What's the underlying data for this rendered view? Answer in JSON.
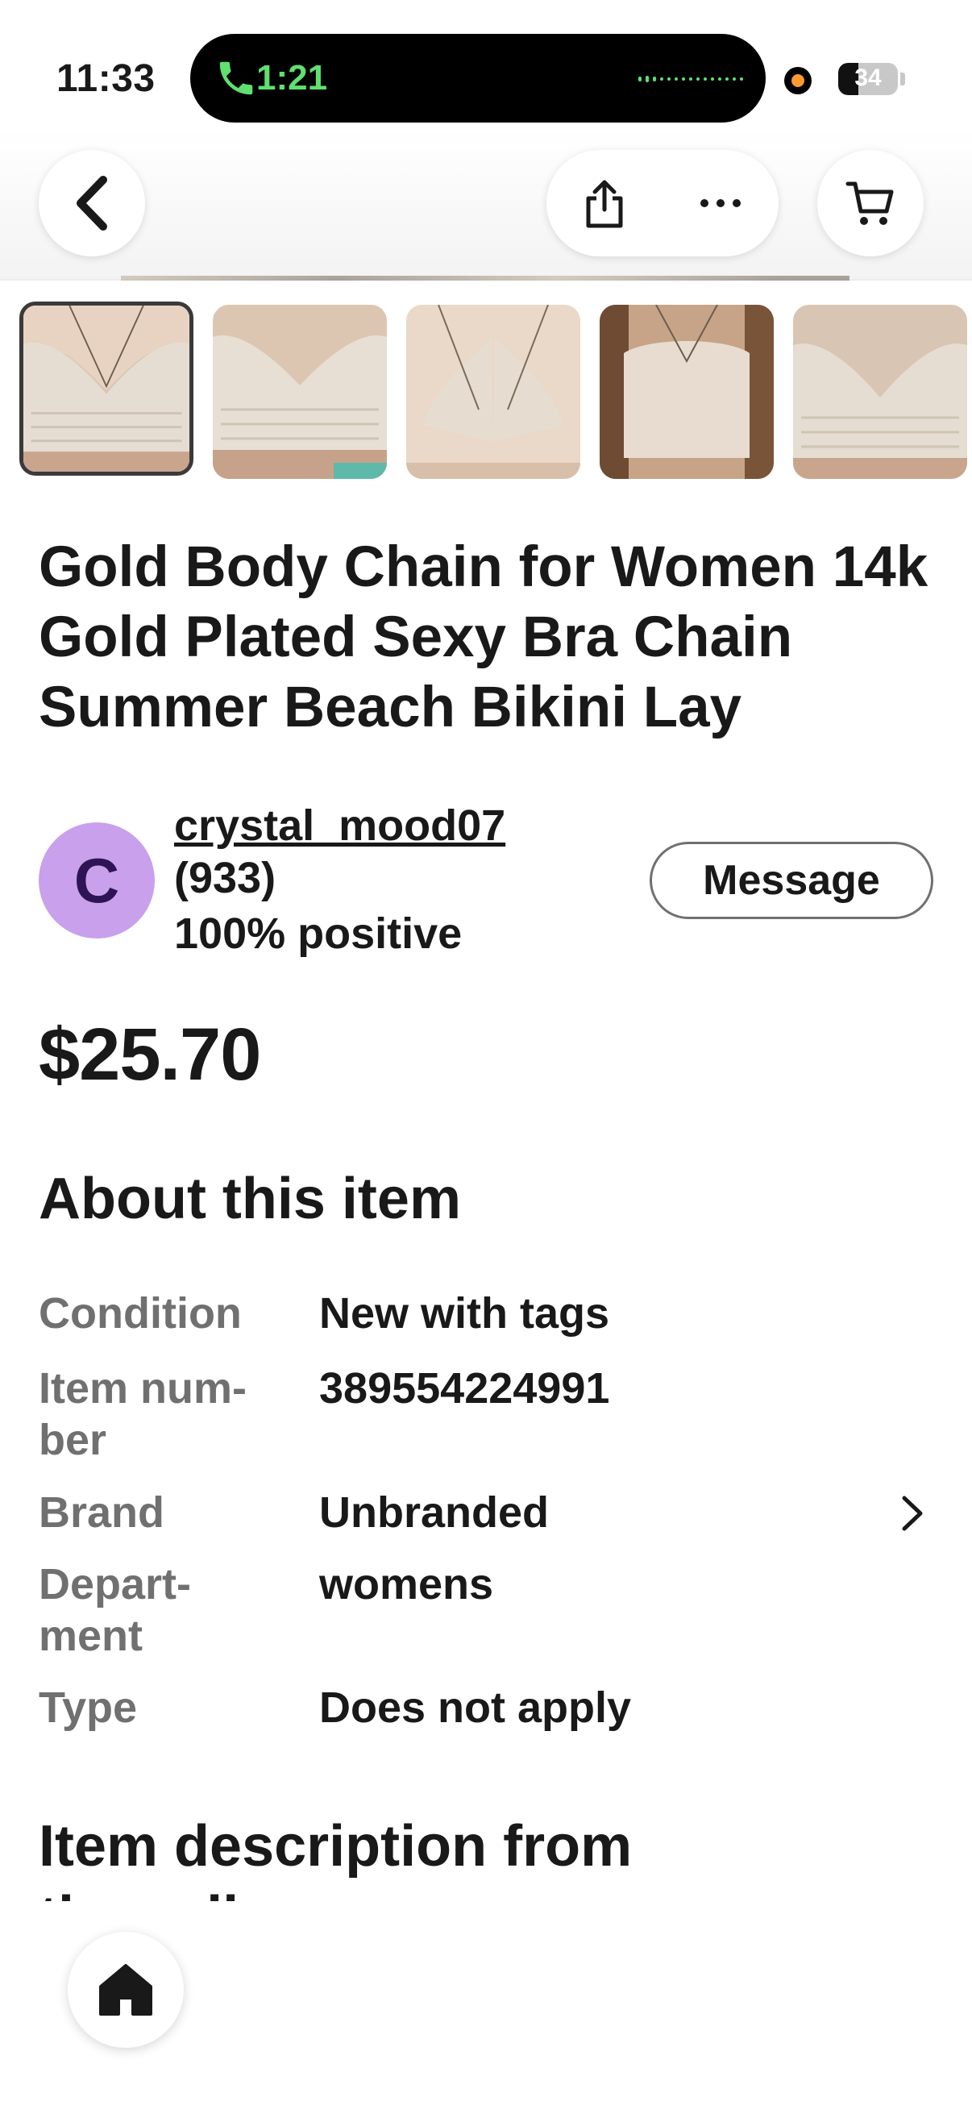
{
  "status_bar": {
    "time": "11:33",
    "call_time": "1:21",
    "battery_percent": "34",
    "battery_level": 0.34,
    "call_color": "#5fe06f"
  },
  "nav": {
    "back_icon": "chevron-left-icon",
    "share_icon": "share-icon",
    "more_icon": "more-horizontal-icon",
    "cart_icon": "cart-icon"
  },
  "gallery": {
    "thumbnails": [
      {
        "name": "thumbnail-1",
        "selected": true
      },
      {
        "name": "thumbnail-2",
        "selected": false
      },
      {
        "name": "thumbnail-3",
        "selected": false
      },
      {
        "name": "thumbnail-4",
        "selected": false
      },
      {
        "name": "thumbnail-5",
        "selected": false
      }
    ]
  },
  "product": {
    "title": "Gold Body Chain for Women 14k Gold Plated Sexy Bra Chain Summer Beach Bikini Lay",
    "price": "$25.70"
  },
  "seller": {
    "avatar_letter": "C",
    "avatar_color": "#c9a0ec",
    "name": "crystal_mood07",
    "feedback_count": "(933)",
    "positive": "100% positive",
    "message_label": "Message"
  },
  "about": {
    "heading": "About this item",
    "specs": [
      {
        "label_line1": "Condition",
        "label_line2": "",
        "value": "New with tags"
      },
      {
        "label_line1": "Item num-",
        "label_line2": "ber",
        "value": "389554224991"
      },
      {
        "label_line1": "Brand",
        "label_line2": "",
        "value": "Unbranded"
      },
      {
        "label_line1": "Depart-",
        "label_line2": "ment",
        "value": "womens"
      },
      {
        "label_line1": "Type",
        "label_line2": "",
        "value": "Does not apply"
      }
    ]
  },
  "description": {
    "heading_line1": "Item description from",
    "heading_line2": "the seller"
  },
  "bottom": {
    "home_icon": "home-icon"
  }
}
